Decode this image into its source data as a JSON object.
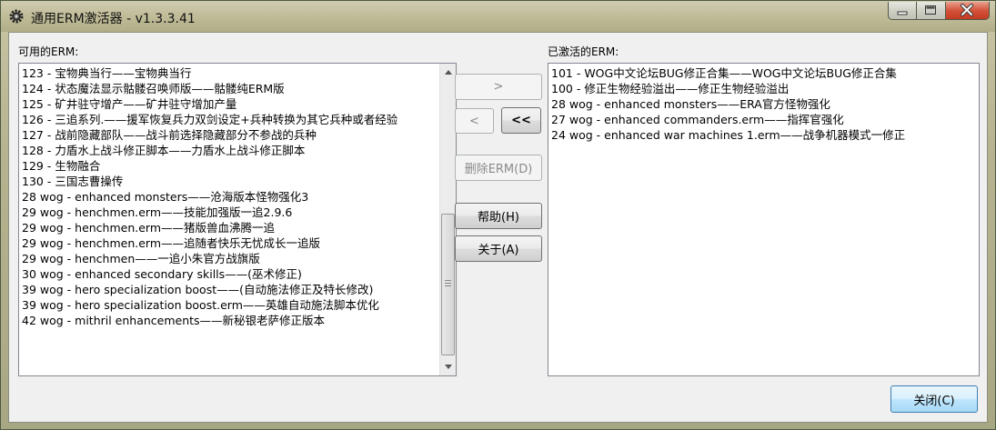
{
  "window": {
    "title": "通用ERM激活器 - v1.3.3.41",
    "icons": {
      "app": "gear-icon",
      "minimize": "minimize-icon",
      "maximize": "maximize-icon",
      "close": "close-icon"
    }
  },
  "available": {
    "label": "可用的ERM:",
    "items": [
      "123 - 宝物典当行——宝物典当行",
      "124 - 状态魔法显示骷髅召唤师版——骷髅纯ERM版",
      "125 - 矿井驻守增产——矿井驻守增加产量",
      "126 - 三追系列.——援军恢复兵力双剑设定+兵种转换为其它兵种或者经验",
      "127 - 战前隐藏部队——战斗前选择隐藏部分不参战的兵种",
      "128 - 力盾水上战斗修正脚本——力盾水上战斗修正脚本",
      "129 - 生物融合",
      "130 - 三国志曹操传",
      "28 wog - enhanced monsters——沧海版本怪物强化3",
      "29 wog - henchmen.erm——技能加强版一追2.9.6",
      "29 wog - henchmen.erm——猪版兽血沸腾一追",
      "29 wog - henchmen.erm——追随者快乐无忧成长一追版",
      "29 wog - henchmen——一追小朱官方战旗版",
      "30 wog - enhanced secondary skills——(巫术修正)",
      "39 wog - hero specialization boost——(自动施法修正及特长修改)",
      "39 wog - hero specialization boost.erm——英雄自动施法脚本优化",
      "42 wog - mithril enhancements——新秘银老萨修正版本"
    ]
  },
  "activated": {
    "label": "已激活的ERM:",
    "items": [
      "101 - WOG中文论坛BUG修正合集——WOG中文论坛BUG修正合集",
      "100 - 修正生物经验溢出——修正生物经验溢出",
      "28 wog - enhanced monsters——ERA官方怪物强化",
      "27 wog - enhanced commanders.erm——指挥官强化",
      "24 wog - enhanced war machines 1.erm——战争机器模式一修正"
    ]
  },
  "buttons": {
    "add": ">",
    "remove": "<",
    "remove_all": "<<",
    "delete": "删除ERM(D)",
    "help": "帮助(H)",
    "about": "关于(A)",
    "close": "关闭(C)"
  }
}
